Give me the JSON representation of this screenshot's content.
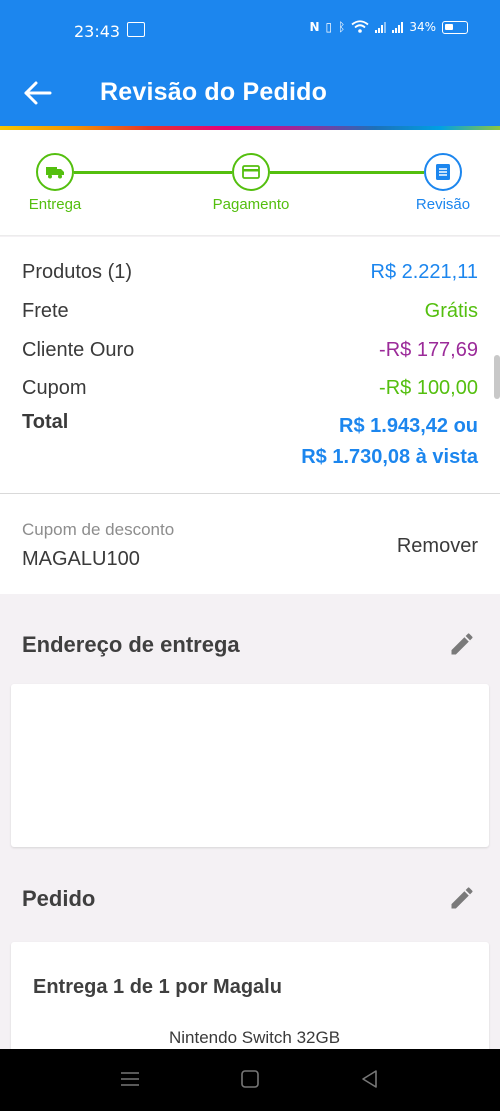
{
  "status_bar": {
    "time": "23:43",
    "battery": "34%"
  },
  "header": {
    "title": "Revisão do Pedido",
    "bg_color": "#1c86ee"
  },
  "stepper": {
    "steps": [
      {
        "label": "Entrega",
        "icon": "truck-icon",
        "state": "done"
      },
      {
        "label": "Pagamento",
        "icon": "credit-card-icon",
        "state": "done"
      },
      {
        "label": "Revisão",
        "icon": "document-icon",
        "state": "current"
      }
    ],
    "done_color": "#54bf0f",
    "current_color": "#1c86ee"
  },
  "summary": {
    "products_label": "Produtos (1)",
    "products_value": "R$ 2.221,11",
    "shipping_label": "Frete",
    "shipping_value": "Grátis",
    "gold_label": "Cliente Ouro",
    "gold_value": "-R$ 177,69",
    "coupon_label": "Cupom",
    "coupon_value": "-R$ 100,00",
    "total_label": "Total",
    "total_value_line1": "R$ 1.943,42 ou",
    "total_value_line2": "R$ 1.730,08 à vista"
  },
  "coupon": {
    "caption": "Cupom de desconto",
    "code": "MAGALU100",
    "remove_label": "Remover"
  },
  "address_section": {
    "title": "Endereço de entrega"
  },
  "order_section": {
    "title": "Pedido",
    "delivery_title": "Entrega 1 de 1 por Magalu",
    "product_name": "Nintendo Switch 32GB"
  }
}
